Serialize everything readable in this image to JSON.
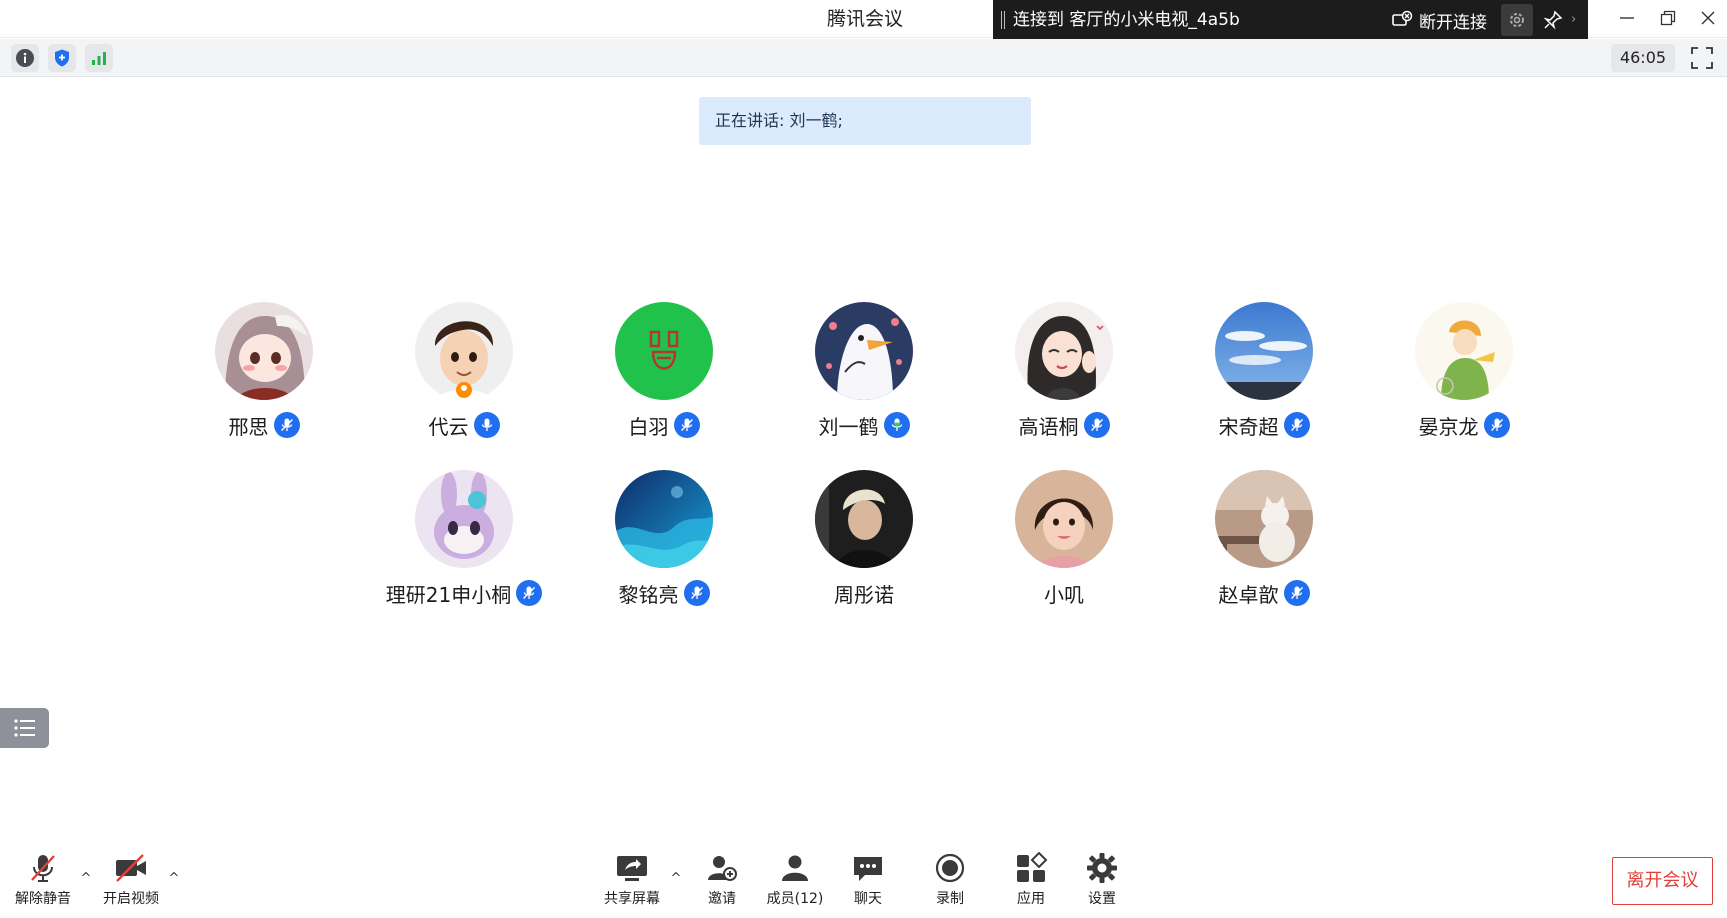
{
  "window": {
    "title": "腾讯会议",
    "cast_status": "连接到 客厅的小米电视_4a5b",
    "disconnect_label": "断开连接"
  },
  "status": {
    "timer": "46:05"
  },
  "speaking_banner": "正在讲话: 刘一鹤;",
  "participants": [
    {
      "name": "邢思",
      "mic": "muted"
    },
    {
      "name": "代云",
      "mic": "on"
    },
    {
      "name": "白羽",
      "mic": "muted"
    },
    {
      "name": "刘一鹤",
      "mic": "talking"
    },
    {
      "name": "高语桐",
      "mic": "muted"
    },
    {
      "name": "宋奇超",
      "mic": "muted"
    },
    {
      "name": "晏京龙",
      "mic": "muted"
    },
    {
      "name": "理研21申小桐",
      "mic": "muted"
    },
    {
      "name": "黎铭亮",
      "mic": "muted"
    },
    {
      "name": "周彤诺",
      "mic": "none"
    },
    {
      "name": "小叽",
      "mic": "none"
    },
    {
      "name": "赵卓歆",
      "mic": "muted"
    }
  ],
  "toolbar": {
    "unmute": "解除静音",
    "start_video": "开启视频",
    "share_screen": "共享屏幕",
    "invite": "邀请",
    "members": "成员(12)",
    "chat": "聊天",
    "record": "录制",
    "apps": "应用",
    "settings": "设置",
    "leave": "离开会议"
  },
  "colors": {
    "accent_blue": "#1f6ff0",
    "speaking_bg": "#dbeafd",
    "leave_red": "#e0403b",
    "cast_bar": "#1c1c1c"
  },
  "icons": [
    "info-icon",
    "shield-icon",
    "signal-icon",
    "fullscreen-icon",
    "list-icon",
    "mic-off-icon",
    "video-off-icon",
    "share-screen-icon",
    "invite-icon",
    "members-icon",
    "chat-icon",
    "record-icon",
    "apps-icon",
    "gear-icon"
  ]
}
